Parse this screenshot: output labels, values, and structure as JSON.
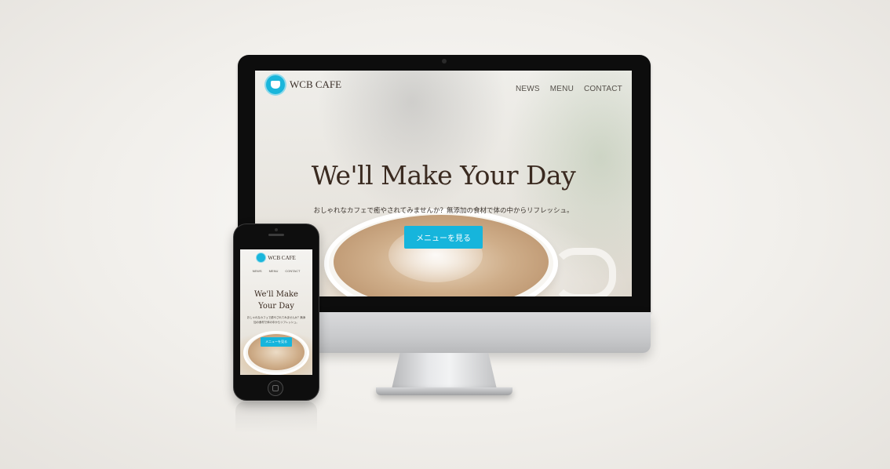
{
  "desktop": {
    "brand": "WCB CAFE",
    "nav": [
      "NEWS",
      "MENU",
      "CONTACT"
    ],
    "hero_title": "We'll Make Your Day",
    "hero_subtitle": "おしゃれなカフェで癒やされてみませんか？無添加の食材で体の中からリフレッシュ。",
    "cta_label": "メニューを見る"
  },
  "mobile": {
    "brand": "WCB CAFE",
    "nav": [
      "NEWS",
      "MENU",
      "CONTACT"
    ],
    "hero_title": "We'll Make Your Day",
    "hero_subtitle": "おしゃれなカフェで癒やされてみませんか？無添加の食材で体の中からリフレッシュ。",
    "cta_label": "メニューを見る"
  },
  "colors": {
    "accent": "#16b5dc",
    "title_text": "#3a2a20"
  }
}
